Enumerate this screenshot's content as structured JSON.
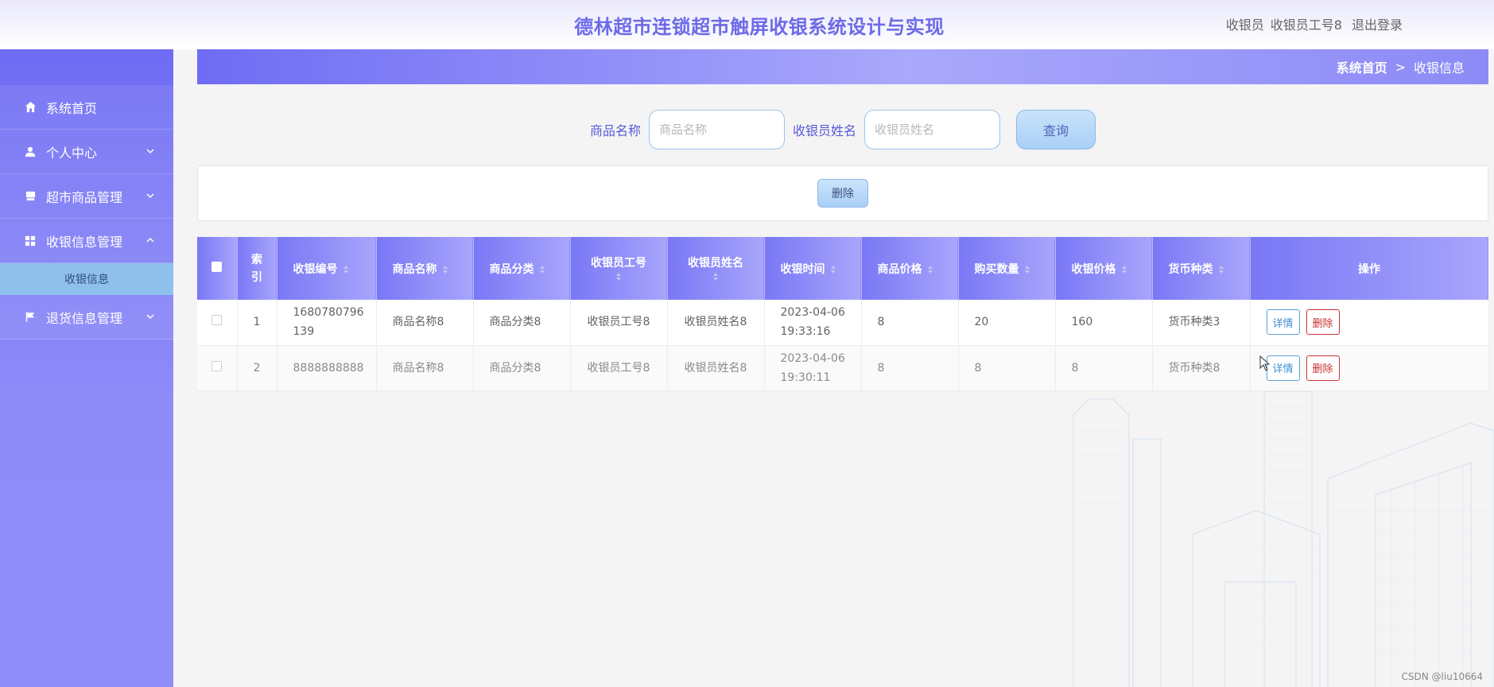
{
  "header": {
    "title": "德林超市连锁超市触屏收银系统设计与实现",
    "user_role": "收银员",
    "user_name": "收银员工号8",
    "logout": "退出登录"
  },
  "sidebar": {
    "items": [
      {
        "label": "系统首页",
        "icon": "home-icon"
      },
      {
        "label": "个人中心",
        "icon": "user-icon"
      },
      {
        "label": "超市商品管理",
        "icon": "store-icon"
      },
      {
        "label": "收银信息管理",
        "icon": "grid-icon"
      },
      {
        "label": "退货信息管理",
        "icon": "flag-icon"
      }
    ],
    "submenu": {
      "label": "收银信息"
    }
  },
  "breadcrumb": {
    "home": "系统首页",
    "separator": ">",
    "current": "收银信息"
  },
  "search": {
    "product_label": "商品名称",
    "product_placeholder": "商品名称",
    "cashier_label": "收银员姓名",
    "cashier_placeholder": "收银员姓名",
    "query_button": "查询"
  },
  "actions": {
    "batch_delete": "删除"
  },
  "table": {
    "headers": {
      "index": "索引",
      "code": "收银编号",
      "product_name": "商品名称",
      "category": "商品分类",
      "cashier_no": "收银员工号",
      "cashier_name": "收银员姓名",
      "time": "收银时间",
      "price": "商品价格",
      "qty": "购买数量",
      "amount": "收银价格",
      "currency": "货币种类",
      "ops": "操作"
    },
    "rows": [
      {
        "index": "1",
        "code": "1680780796139",
        "product_name": "商品名称8",
        "category": "商品分类8",
        "cashier_no": "收银员工号8",
        "cashier_name": "收银员姓名8",
        "time": "2023-04-06 19:33:16",
        "price": "8",
        "qty": "20",
        "amount": "160",
        "currency": "货币种类3"
      },
      {
        "index": "2",
        "code": "8888888888",
        "product_name": "商品名称8",
        "category": "商品分类8",
        "cashier_no": "收银员工号8",
        "cashier_name": "收银员姓名8",
        "time": "2023-04-06 19:30:11",
        "price": "8",
        "qty": "8",
        "amount": "8",
        "currency": "货币种类8"
      }
    ],
    "row_buttons": {
      "detail": "详情",
      "delete": "删除"
    }
  },
  "watermark": "CSDN @liu10664",
  "colors": {
    "accent": "#6f6cf4",
    "title": "#6d6ae8",
    "delete": "#c63030",
    "detail": "#3f8fd3"
  }
}
